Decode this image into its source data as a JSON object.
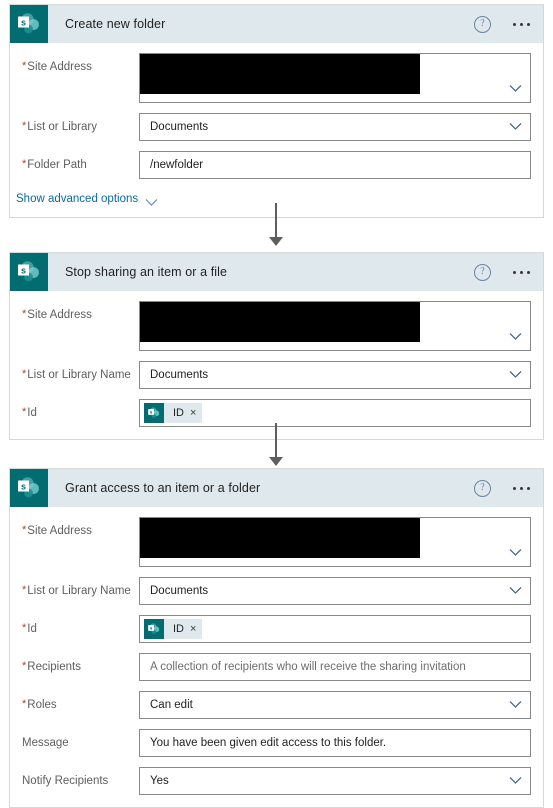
{
  "cards": [
    {
      "title": "Create new folder",
      "icon": "sharepoint-icon",
      "help_icon": "help-icon",
      "menu_icon": "ellipsis-icon",
      "fields": [
        {
          "label": "Site Address",
          "required": true,
          "type": "dropdown-redacted",
          "value": ""
        },
        {
          "label": "List or Library",
          "required": true,
          "type": "dropdown",
          "value": "Documents"
        },
        {
          "label": "Folder Path",
          "required": true,
          "type": "text",
          "value": "/newfolder"
        }
      ],
      "advanced_link": "Show advanced options"
    },
    {
      "title": "Stop sharing an item or a file",
      "icon": "sharepoint-icon",
      "help_icon": "help-icon",
      "menu_icon": "ellipsis-icon",
      "fields": [
        {
          "label": "Site Address",
          "required": true,
          "type": "dropdown-redacted",
          "value": ""
        },
        {
          "label": "List or Library Name",
          "required": true,
          "type": "dropdown",
          "value": "Documents"
        },
        {
          "label": "Id",
          "required": true,
          "type": "token",
          "token_label": "ID",
          "token_remove": "×"
        }
      ]
    },
    {
      "title": "Grant access to an item or a folder",
      "icon": "sharepoint-icon",
      "help_icon": "help-icon",
      "menu_icon": "ellipsis-icon",
      "fields": [
        {
          "label": "Site Address",
          "required": true,
          "type": "dropdown-redacted",
          "value": ""
        },
        {
          "label": "List or Library Name",
          "required": true,
          "type": "dropdown",
          "value": "Documents"
        },
        {
          "label": "Id",
          "required": true,
          "type": "token",
          "token_label": "ID",
          "token_remove": "×"
        },
        {
          "label": "Recipients",
          "required": true,
          "type": "text",
          "value": "A collection of recipients who will receive the sharing invitation",
          "is_placeholder": true
        },
        {
          "label": "Roles",
          "required": true,
          "type": "dropdown",
          "value": "Can edit"
        },
        {
          "label": "Message",
          "required": false,
          "type": "text",
          "value": "You have been given edit access to this folder."
        },
        {
          "label": "Notify Recipients",
          "required": false,
          "type": "dropdown",
          "value": "Yes"
        }
      ]
    }
  ],
  "symbols": {
    "required_marker": "*",
    "help_glyph": "?"
  },
  "colors": {
    "brand_teal": "#036c70",
    "header_background": "#dfe9ed",
    "link_blue": "#0b6a9e",
    "required_red": "#c0392b",
    "border_gray": "#8a8886"
  }
}
